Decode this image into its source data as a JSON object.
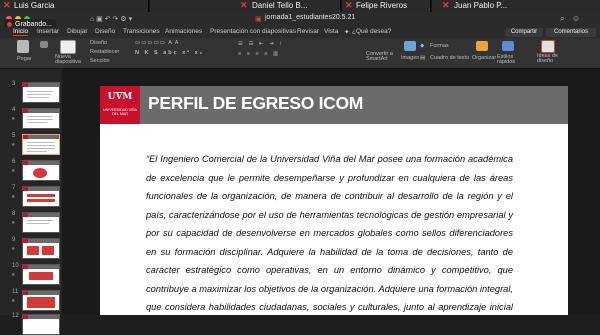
{
  "participants": [
    {
      "name": "Luis Garcia"
    },
    {
      "name": "Daniel Tello B..."
    },
    {
      "name": "Felipe Riveros"
    },
    {
      "name": "Juan Pablo P..."
    }
  ],
  "recording_label": "Grabando...",
  "window": {
    "title": "jornada1_estudiantes20.5.21"
  },
  "tabs": [
    "Inicio",
    "Insertar",
    "Dibujar",
    "Diseño",
    "Transiciones",
    "Animaciones",
    "Presentación con diapositivas",
    "Revisar",
    "Vista"
  ],
  "tell_me": "¿Qué desea?",
  "share_label": "Compartir",
  "comments_label": "Comentarios",
  "ribbon": {
    "paste": "Pegar",
    "new_slide": "Nueva diapositiva",
    "layout": "Diseño",
    "reset": "Restablecer",
    "section": "Sección",
    "convert_smartart": "Convertir a SmartArt",
    "image": "Imagen",
    "shapes": "Formas",
    "textbox": "Cuadro de texto",
    "arrange": "Organizar",
    "quick_styles": "Estilos rápidos",
    "design_ideas": "Ideas de diseño"
  },
  "thumbnails": [
    {
      "num": "3"
    },
    {
      "num": "4"
    },
    {
      "num": "5"
    },
    {
      "num": "6"
    },
    {
      "num": "7"
    },
    {
      "num": "8"
    },
    {
      "num": "9"
    },
    {
      "num": "10"
    },
    {
      "num": "11"
    },
    {
      "num": "12"
    }
  ],
  "slide": {
    "logo_text": "UVM",
    "logo_sub": "UNIVERSIDAD VIÑA DEL MAR",
    "title": "PERFIL DE EGRESO ICOM",
    "body": "“El Ingeniero Comercial de la Universidad Viña del Mar posee una formación académica de excelencia que le permite desempeñarse y profundizar en cualquiera de las áreas funcionales de la organización, de manera de contribuir al desarrollo de la región y el país, caracterizándose por el uso de herramientas tecnológicas de gestión empresarial y por su capacidad de desenvolverse en mercados globales como sellos diferenciadores en su formación disciplinar. Adquiere la habilidad de la toma de decisiones, tanto de carácter estratégico como operativas, en un entorno dinámico y competitivo, que contribuye a maximizar los objetivos de la organización. Adquiere una formación integral, que considera habilidades ciudadanas, sociales y culturales, junto al aprendizaje inicial de una segunda lengua”"
  },
  "colors": {
    "accent": "#c8102e",
    "header_bg": "#6b6b6b",
    "ribbon_accent": "#d24726"
  }
}
